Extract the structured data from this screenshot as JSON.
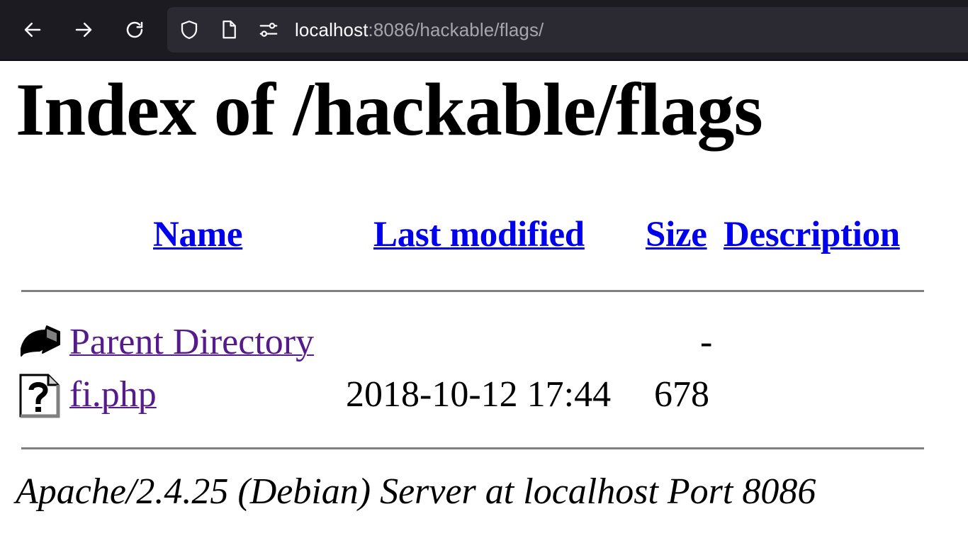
{
  "browser": {
    "url_host": "localhost",
    "url_rest": ":8086/hackable/flags/",
    "back_icon": "arrow-left-icon",
    "forward_icon": "arrow-right-icon",
    "reload_icon": "reload-icon",
    "shield_icon": "shield-icon",
    "page_icon": "page-icon",
    "permissions_icon": "permissions-icon"
  },
  "page": {
    "title": "Index of /hackable/flags",
    "columns": {
      "name": "Name",
      "last_modified": "Last modified",
      "size": "Size",
      "description": "Description"
    },
    "rows": [
      {
        "icon": "back-arrow-icon",
        "name": "Parent Directory",
        "last_modified": "",
        "size": "-",
        "description": ""
      },
      {
        "icon": "unknown-file-icon",
        "name": "fi.php",
        "last_modified": "2018-10-12 17:44",
        "size": "678",
        "description": ""
      }
    ],
    "footer": "Apache/2.4.25 (Debian) Server at localhost Port 8086"
  },
  "colors": {
    "link": "#0000ee",
    "visited_link": "#551a8b",
    "toolbar_bg": "#1c1b22",
    "urlbar_bg": "#2b2a33"
  }
}
